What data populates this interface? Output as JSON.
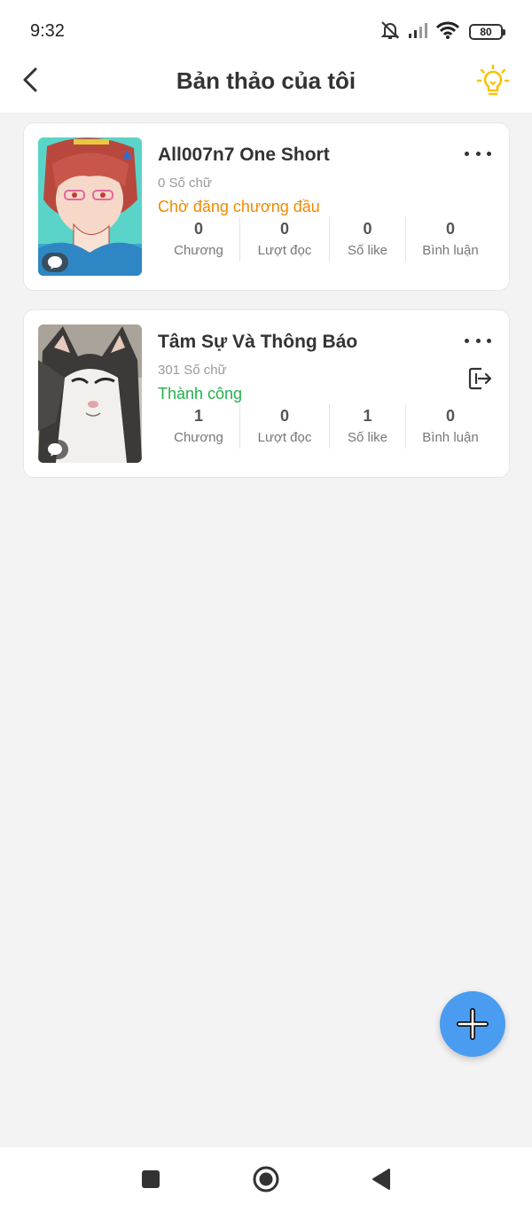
{
  "status_bar": {
    "time": "9:32",
    "battery": "80"
  },
  "header": {
    "title": "Bản thảo của tôi"
  },
  "colors": {
    "accent": "#4a9cf0",
    "pending": "#f08a00",
    "success": "#22b14c",
    "bulb": "#f5c400"
  },
  "drafts": [
    {
      "title": "All007n7 One Short",
      "word_count": "0 Số chữ",
      "status": "Chờ đăng chương đầu",
      "status_type": "pending",
      "stats": [
        {
          "value": "0",
          "label": "Chương"
        },
        {
          "value": "0",
          "label": "Lượt đọc"
        },
        {
          "value": "0",
          "label": "Số like"
        },
        {
          "value": "0",
          "label": "Bình luận"
        }
      ]
    },
    {
      "title": "Tâm Sự Và Thông Báo",
      "word_count": "301 Số chữ",
      "status": "Thành công",
      "status_type": "success",
      "stats": [
        {
          "value": "1",
          "label": "Chương"
        },
        {
          "value": "0",
          "label": "Lượt đọc"
        },
        {
          "value": "1",
          "label": "Số like"
        },
        {
          "value": "0",
          "label": "Bình luận"
        }
      ]
    }
  ],
  "icons": {
    "back": "chevron-left-icon",
    "tips": "lightbulb-icon",
    "more": "more-dots-icon",
    "export": "export-icon",
    "comment": "chat-bubble-icon",
    "add": "plus-icon",
    "nav": [
      "square-recents-icon",
      "circle-home-icon",
      "triangle-back-icon"
    ]
  }
}
